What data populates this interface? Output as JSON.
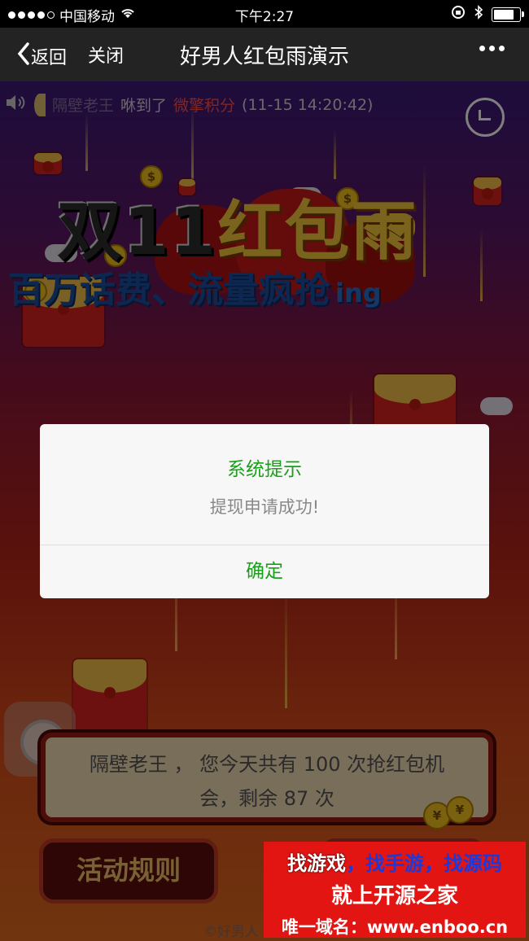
{
  "status_bar": {
    "carrier": "中国移动",
    "time": "下午2:27",
    "signal_dots": 5,
    "signal_filled": 4,
    "battery_level": 0.85
  },
  "nav": {
    "back_label": "返回",
    "close_label": "关闭",
    "title": "好男人红包雨演示"
  },
  "ticker": {
    "name": "隔壁老王",
    "action": "咻到了",
    "item": "微擎积分",
    "time": "(11-15 14:20:42)"
  },
  "banner": {
    "line1_a": "双11",
    "line1_b": "红包雨",
    "line2": "百万话费、流量疯抢",
    "line2_suffix": "ing"
  },
  "message": {
    "line1": "隔壁老王 ， 您今天共有 100 次抢红包机",
    "line2": "会，剩余 87 次"
  },
  "rule_button": "活动规则",
  "footer_copy": "©好男人",
  "dialog": {
    "title": "系统提示",
    "message": "提现申请成功!",
    "confirm": "确定"
  },
  "ad": {
    "line1_a": "找游戏",
    "line1_b": "，找手游，找源码",
    "line2": "就上开源之家",
    "line3": "唯一域名：www.enboo.cn"
  },
  "colors": {
    "accent_green": "#1aa01a",
    "ad_red": "#e21513",
    "highlight_red": "#ff4d4d"
  }
}
